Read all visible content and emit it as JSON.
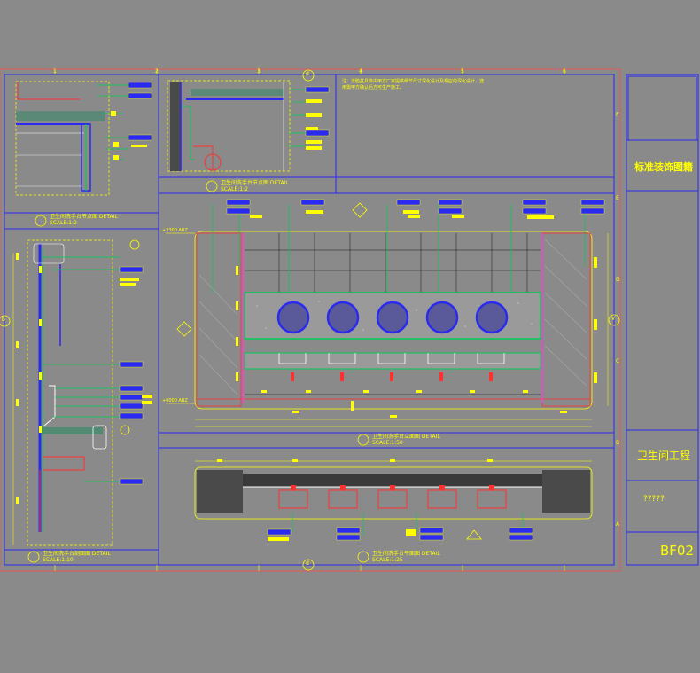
{
  "title_block": {
    "sheet_title": "标准装饰图籍",
    "project_name": "卫生间工程",
    "placeholder": "?????",
    "sheet_number": "BF02"
  },
  "note": "注：洗脸盆具体由甲方厂家提供细节尺寸深化设计及相应的深化设计，选用需甲方确认后方可生产施工。",
  "details": [
    {
      "id": "b",
      "label": "卫生间洗手台节点图   DETAIL",
      "scale": "SCALE:1:2"
    },
    {
      "id": "c",
      "label": "卫生间洗手台节点图   DETAIL",
      "scale": "SCALE:1:2"
    },
    {
      "id": "A",
      "label": "卫生间洗手台立面图   DETAIL",
      "scale": "SCALE:1:50"
    },
    {
      "id": "a",
      "label": "卫生间洗手台剖面图   DETAIL",
      "scale": "SCALE:1:10"
    },
    {
      "id": "1",
      "label": "卫生间洗手台平面图   DETAIL",
      "scale": "SCALE:1:25"
    }
  ],
  "levels": {
    "top": "+3300 ABZ",
    "bottom": "+0000 ABZ"
  },
  "section_markers": {
    "top": "d",
    "bottom": "d",
    "left": "b",
    "right": "V"
  },
  "grid_numbers": [
    "1",
    "2",
    "3",
    "4",
    "5",
    "6"
  ],
  "grid_letters": [
    "F",
    "E",
    "D",
    "C",
    "B",
    "A"
  ]
}
